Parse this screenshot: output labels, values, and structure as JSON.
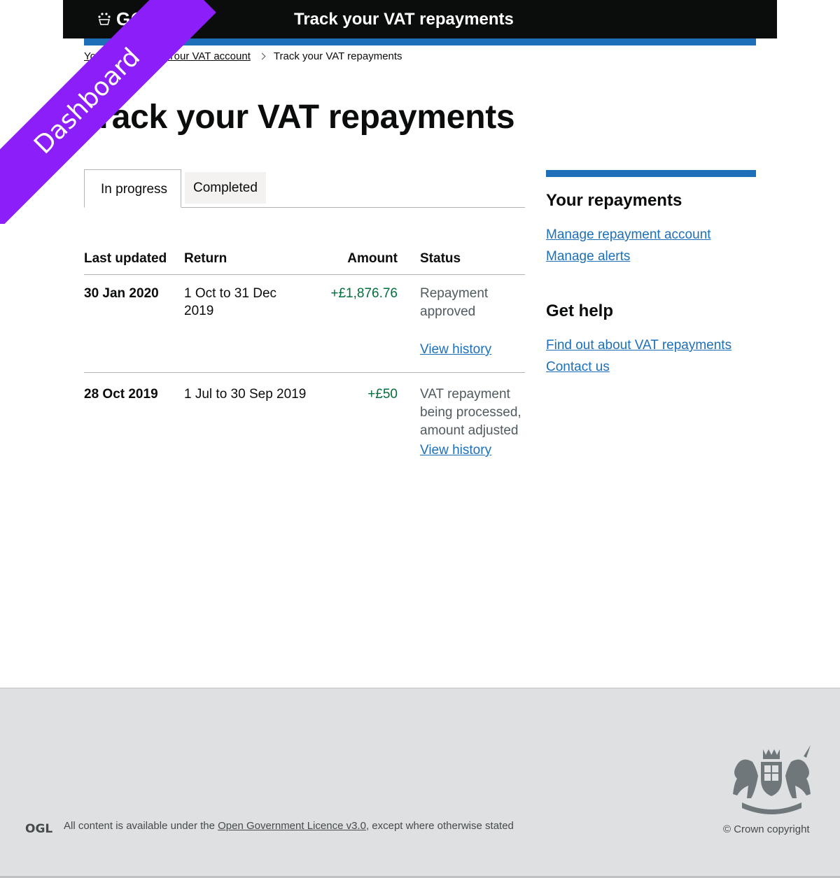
{
  "header": {
    "logo_text": "GOV.UK",
    "service_title": "Track your VAT repayments"
  },
  "breadcrumb": {
    "items": [
      "Your account",
      "Your VAT account"
    ],
    "current": "Track your VAT repayments"
  },
  "page_title": "Track your VAT repayments",
  "tabs": [
    {
      "label": "In progress",
      "active": true
    },
    {
      "label": "Completed",
      "active": false
    }
  ],
  "table": {
    "headers": [
      "Last updated",
      "Return",
      "Amount",
      "Status"
    ],
    "rows": [
      {
        "last_updated": "30 Jan 2020",
        "return": "1 Oct to 31 Dec 2019",
        "amount": "+£1,876.76",
        "status": "Repayment approved",
        "link": "View history"
      },
      {
        "last_updated": "28 Oct 2019",
        "return": "1 Jul to 30 Sep 2019",
        "amount": "+£50",
        "status": "VAT repayment being processed, amount adjusted",
        "link": "View history"
      }
    ]
  },
  "sidebar": {
    "section1_title": "Your repayments",
    "section1_links": [
      "Manage repayment account",
      "Manage alerts"
    ],
    "section2_title": "Get help",
    "section2_links": [
      "Find out about VAT repayments",
      "Contact us"
    ]
  },
  "footer": {
    "licence_prefix": "All content is available under the ",
    "licence_link": "Open Government Licence v3.0",
    "licence_suffix": ", except where otherwise stated",
    "copyright": "© Crown copyright",
    "ogl_text": "OGL"
  },
  "ribbon": {
    "label": "Dashboard",
    "color": "#8c1ef9"
  },
  "colors": {
    "header_bg": "#0b0c0c",
    "accent_blue": "#1d70b8",
    "amount_green": "#00703c",
    "footer_bg": "#dee0e2"
  }
}
